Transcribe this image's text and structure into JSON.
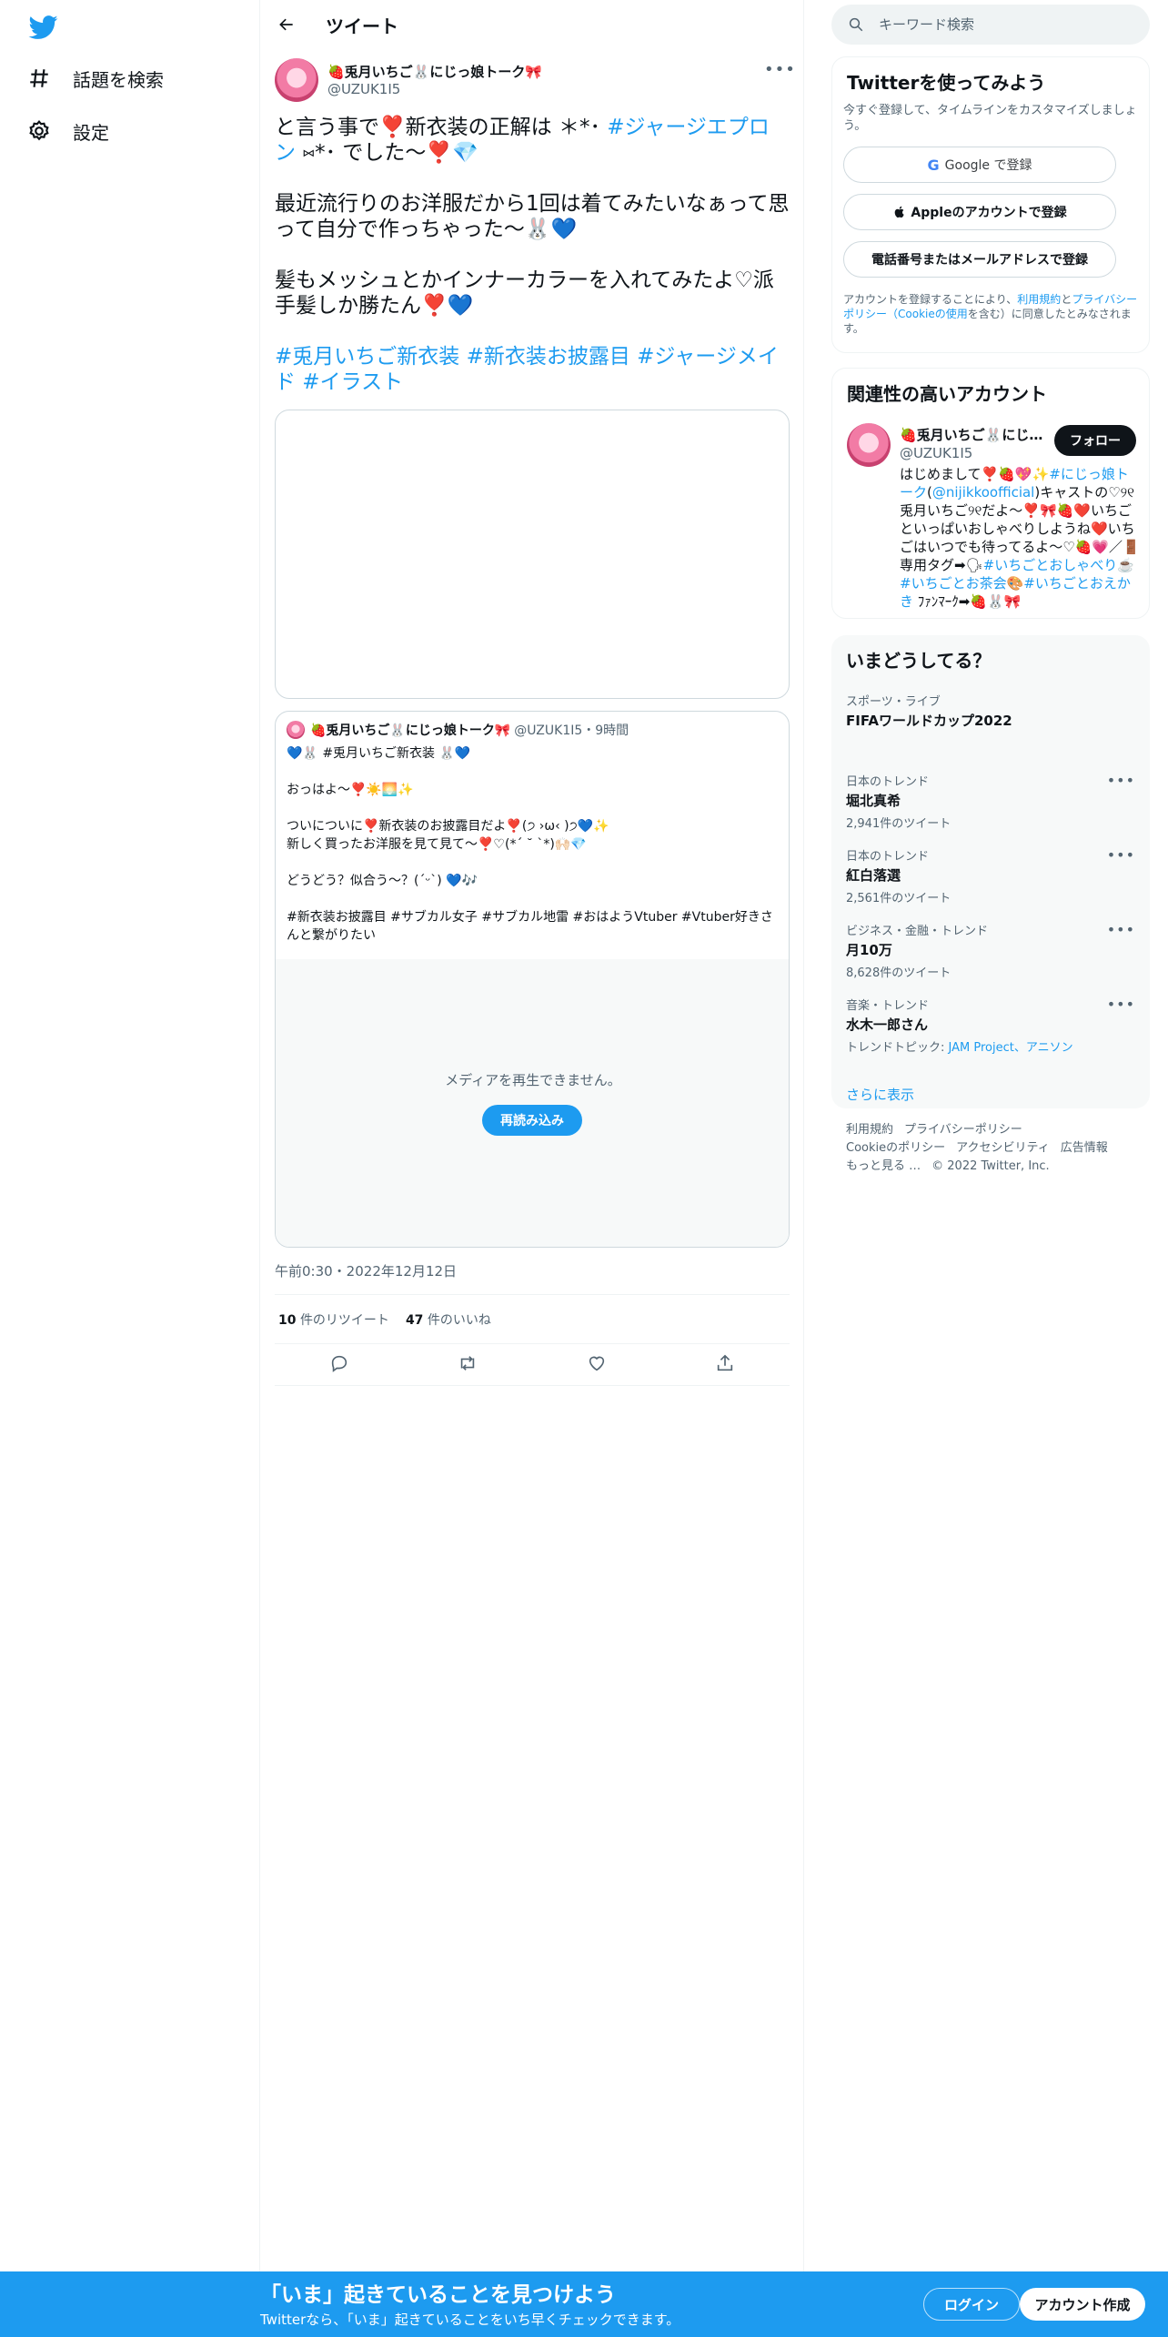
{
  "nav": {
    "items": [
      {
        "label": "話題を検索"
      },
      {
        "label": "設定"
      }
    ]
  },
  "header": {
    "title": "ツイート"
  },
  "tweet": {
    "author_name": "🍓兎月いちご🐰にじっ娘トーク🎀",
    "author_handle": "@UZUK1I5",
    "paragraph_1_text": "と言う事で❣️新衣装の正解は ＊*･",
    "paragraph_1_link": "#ジャージエプロン",
    "paragraph_1_tail": "⑅*･ でした〜❣️💎",
    "paragraph_2": "最近流行りのお洋服だから1回は着てみたいなぁって思って自分で作っちゃった〜🐰💙",
    "paragraph_3": "髪もメッシュとかインナーカラーを入れてみたよ♡派手髪しか勝たん❣️💙",
    "hashtags": "#兎月いちご新衣装 #新衣装お披露目 #ジャージメイド #イラスト",
    "timestamp": "午前0:30・2022年12月12日",
    "retweets_count": "10",
    "retweets_label": "件のリツイート",
    "likes_count": "47",
    "likes_label": "件のいいね"
  },
  "quote": {
    "author_name": "🍓兎月いちご🐰にじっ娘トーク🎀",
    "handle_time": "@UZUK1I5・9時間",
    "line_1": "💙🐰 #兎月いちご新衣装 🐰💙",
    "line_2": "おっはよ〜❣️☀️🌅✨",
    "line_3": "ついについに❣️新衣装のお披露目だよ❣️(੭ ›ω‹ )੭💙✨",
    "line_4": "新しく買ったお洋服を見て見て〜❣️♡(*´ ˘ `*)🙌🏻💎",
    "line_5": "どうどう？似合う〜？(ˊᵕˋ) 💙🎶",
    "line_6": "#新衣装お披露目 #サブカル女子 #サブカル地雷 #おはようVtuber #Vtuber好きさんと繋がりたい",
    "media_message": "メディアを再生できません。",
    "reload_label": "再読み込み"
  },
  "search": {
    "placeholder": "キーワード検索"
  },
  "signup_card": {
    "title": "Twitterを使ってみよう",
    "subtitle": "今すぐ登録して、タイムラインをカスタマイズしましょう。",
    "google_label": "Google で登録",
    "apple_label": "Appleのアカウントで登録",
    "phone_label": "電話番号またはメールアドレスで登録",
    "terms_prefix": "アカウントを登録することにより、",
    "terms_link_1": "利用規約",
    "terms_mid": "と",
    "terms_link_2": "プライバシーポリシー",
    "terms_link_3": "（Cookieの使用",
    "terms_suffix": "を含む）に同意したとみなされます。"
  },
  "related": {
    "title": "関連性の高いアカウント",
    "name": "🍓兎月いちご🐰にじっ娘トーク🎀",
    "handle": "@UZUK1I5",
    "follow_label": "フォロー",
    "bio_1": "はじめまして❣️🍓💖✨",
    "bio_link_1": "#にじっ娘トーク",
    "bio_2": "(",
    "bio_link_2": "@nijikkoofficial",
    "bio_3": ")キャストの♡୨୧兎月いちご୨୧だよ〜❣️🎀🍓❤️いちごといっぱいおしゃべりしようね❤️いちごはいつでも待ってるよ〜♡🍓💗／🚪専用タグ➡🗣",
    "bio_link_3": "#いちごとおしゃべり",
    "bio_4": "☕️",
    "bio_link_4": "#いちごとお茶会",
    "bio_5": "🎨",
    "bio_link_5": "#いちごとおえかき",
    "bio_6": " ﾌｧﾝﾏｰｸ➡🍓🐰🎀"
  },
  "trends": {
    "title": "いまどうしてる？",
    "items": [
      {
        "category": "スポーツ・ライブ",
        "name": "FIFAワールドカップ2022",
        "count": ""
      },
      {
        "category": "日本のトレンド",
        "name": "堀北真希",
        "count": "2,941件のツイート"
      },
      {
        "category": "日本のトレンド",
        "name": "紅白落選",
        "count": "2,561件のツイート"
      },
      {
        "category": "ビジネス・金融・トレンド",
        "name": "月10万",
        "count": "8,628件のツイート"
      },
      {
        "category": "音楽・トレンド",
        "name": "水木一郎さん",
        "count_prefix": "トレンドトピック: ",
        "count_link": "JAM Project、アニソン"
      }
    ],
    "show_more": "さらに表示"
  },
  "footer": {
    "links": [
      "利用規約",
      "プライバシーポリシー",
      "Cookieのポリシー",
      "アクセシビリティ",
      "広告情報",
      "もっと見る …"
    ],
    "copyright": "© 2022 Twitter, Inc."
  },
  "bottom_bar": {
    "title": "「いま」起きていることを見つけよう",
    "subtitle": "Twitterなら、「いま」起きていることをいち早くチェックできます。",
    "login_label": "ログイン",
    "signup_label": "アカウント作成"
  },
  "colors": {
    "brand": "#1d9bf0",
    "text": "#0f1419",
    "muted": "#536471"
  }
}
